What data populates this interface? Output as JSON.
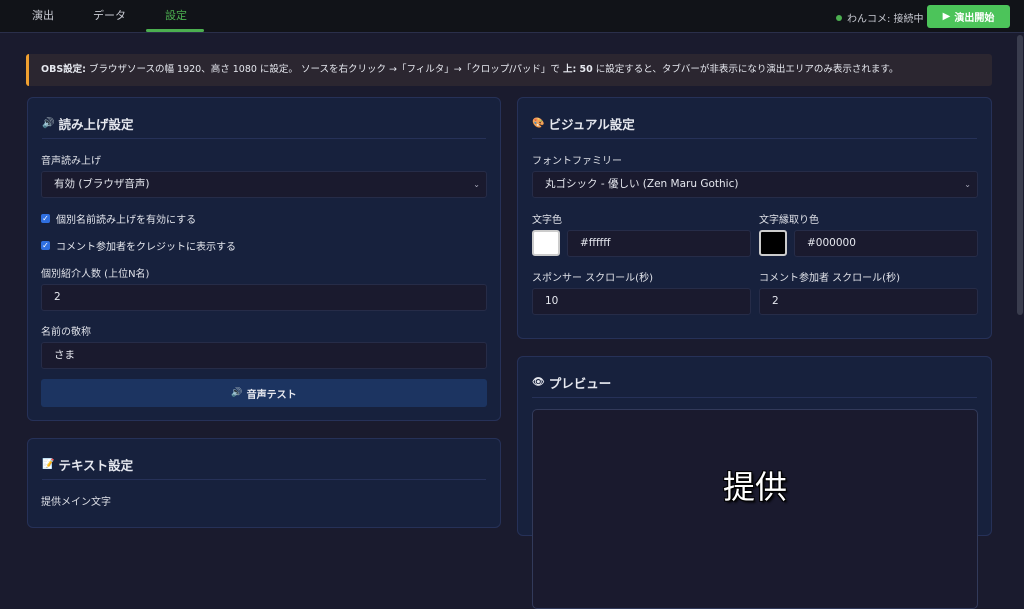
{
  "nav": {
    "tabs": [
      {
        "label": "演出"
      },
      {
        "label": "データ"
      },
      {
        "label": "設定"
      }
    ],
    "active_tab": "設定",
    "status": "わんコメ: 接続中",
    "start_button": "演出開始"
  },
  "notice": {
    "label": "OBS設定:",
    "text_1": " ブラウザソースの幅 1920、高さ 1080 に設定。 ソースを右クリック →「フィルタ」→「クロップ/パッド」で ",
    "bold_2": "上: 50",
    "text_2": " に設定すると、タブバーが非表示になり演出エリアのみ表示されます。"
  },
  "reading": {
    "title": "読み上げ設定",
    "voice_label": "音声読み上げ",
    "voice_value": "有効 (ブラウザ音声)",
    "check_names": "個別名前読み上げを有効にする",
    "check_credits": "コメント参加者をクレジットに表示する",
    "count_label": "個別紹介人数 (上位N名)",
    "count_value": "2",
    "honorific_label": "名前の敬称",
    "honorific_value": "さま",
    "test_button": "音声テスト"
  },
  "visual": {
    "title": "ビジュアル設定",
    "font_label": "フォントファミリー",
    "font_value": "丸ゴシック - 優しい (Zen Maru Gothic)",
    "text_color_label": "文字色",
    "text_color": "#ffffff",
    "outline_label": "文字縁取り色",
    "outline_color": "#000000",
    "sponsor_scroll_label": "スポンサー スクロール(秒)",
    "sponsor_scroll": "10",
    "comment_scroll_label": "コメント参加者 スクロール(秒)",
    "comment_scroll": "2"
  },
  "preview": {
    "title": "プレビュー",
    "text": "提供"
  },
  "text_settings": {
    "title": "テキスト設定",
    "main_label": "提供メイン文字"
  }
}
